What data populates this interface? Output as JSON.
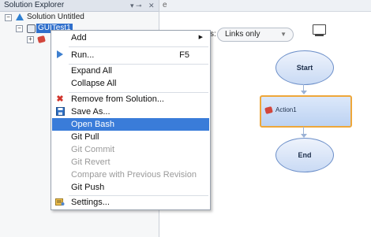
{
  "explorer": {
    "title": "Solution Explorer",
    "pin_glyph": "▾ ⊸",
    "close_glyph": "✕",
    "solution_label": "Solution Untitled",
    "test_label": "GUITest1"
  },
  "canvas": {
    "tab_label": "e",
    "toolbar_label": "s:",
    "links_filter": "Links only",
    "nodes": {
      "start": "Start",
      "action": "Action1",
      "end": "End"
    }
  },
  "context_menu": {
    "items": [
      {
        "label": "Add",
        "icon": "none",
        "submenu": true
      },
      {
        "label": "Run...",
        "shortcut": "F5",
        "icon": "play-icon"
      },
      {
        "label": "Expand All"
      },
      {
        "label": "Collapse All"
      },
      {
        "label": "Remove from Solution...",
        "icon": "remove-icon"
      },
      {
        "label": "Save As...",
        "icon": "save-icon"
      },
      {
        "label": "Open Bash",
        "highlighted": true
      },
      {
        "label": "Git Pull"
      },
      {
        "label": "Git Commit",
        "disabled": true
      },
      {
        "label": "Git Revert",
        "disabled": true
      },
      {
        "label": "Compare with Previous Revision",
        "disabled": true
      },
      {
        "label": "Git Push"
      },
      {
        "label": "Settings...",
        "icon": "settings-icon"
      }
    ],
    "submenu_glyph": "▶"
  },
  "colors": {
    "highlight": "#3a7cd9",
    "selection": "#2f6fcc",
    "action_border": "#eea73a",
    "remove_icon": "#d0342c"
  }
}
